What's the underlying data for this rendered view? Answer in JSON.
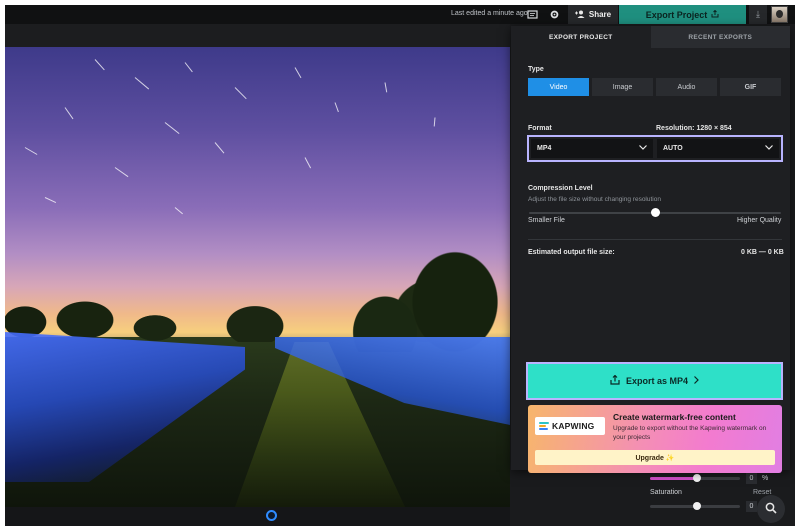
{
  "topbar": {
    "last_edited": "Last edited a minute ago",
    "icons": [
      "comment-icon",
      "gear-icon"
    ],
    "share_label": "Share",
    "export_label": "Export Project",
    "colors": {
      "export_bg": "#1f8f7f"
    }
  },
  "dialog": {
    "tabs": [
      {
        "label": "EXPORT PROJECT",
        "active": true
      },
      {
        "label": "RECENT EXPORTS",
        "active": false
      }
    ],
    "type_label": "Type",
    "type_options": [
      {
        "label": "Video",
        "active": true
      },
      {
        "label": "Image",
        "active": false
      },
      {
        "label": "Audio",
        "active": false
      },
      {
        "label": "GIF",
        "active": false
      }
    ],
    "format_label": "Format",
    "resolution_label": "Resolution: 1280 × 854",
    "format_value": "MP4",
    "resolution_value": "AUTO",
    "compression_label": "Compression Level",
    "compression_desc": "Adjust the file size without changing resolution",
    "compression_level": 0.5,
    "smaller_file": "Smaller File",
    "higher_quality": "Higher Quality",
    "estimated_label": "Estimated output file size:",
    "estimated_value": "0 KB — 0 KB",
    "export_button": "Export as MP4",
    "promo": {
      "logo_text": "KAPWING",
      "title": "Create watermark-free content",
      "desc": "Upgrade to export without the Kapwing watermark on your projects",
      "upgrade_label": "Upgrade ✨"
    }
  },
  "sidepanel": {
    "value_1": "0",
    "pct_1": "%",
    "saturation_label": "Saturation",
    "reset_label": "Reset",
    "value_2": "0"
  },
  "colors": {
    "accent_teal": "#2ee0c8",
    "accent_blue": "#1f8fe6",
    "focus_outline": "#b9b4ff"
  }
}
